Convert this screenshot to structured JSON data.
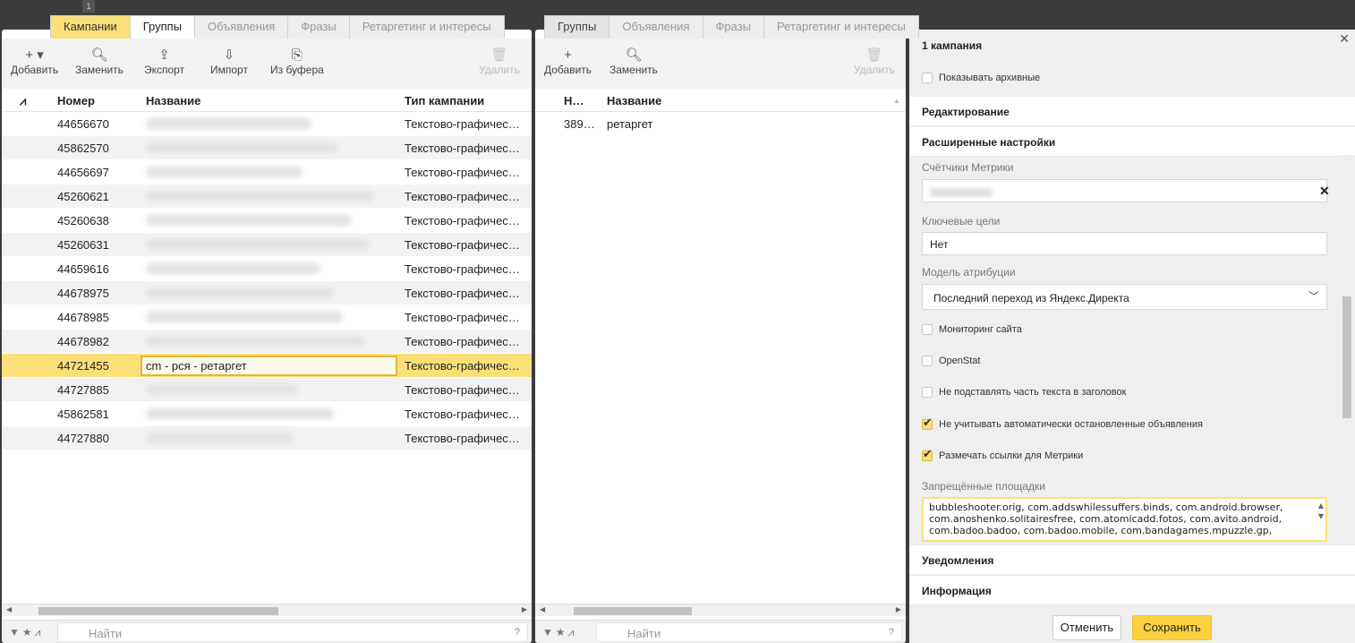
{
  "window_number": "1",
  "left_tabs": [
    {
      "label": "Кампании",
      "state": "active"
    },
    {
      "label": "Группы",
      "state": "selected"
    },
    {
      "label": "Объявления",
      "state": "inactive"
    },
    {
      "label": "Фразы",
      "state": "inactive"
    },
    {
      "label": "Ретаргетинг и интересы",
      "state": "inactive"
    }
  ],
  "middle_tabs": [
    {
      "label": "Группы",
      "state": "active"
    },
    {
      "label": "Объявления",
      "state": "inactive"
    },
    {
      "label": "Фразы",
      "state": "inactive"
    },
    {
      "label": "Ретаргетинг и интересы",
      "state": "inactive"
    }
  ],
  "left_toolbar": {
    "add": "Добавить",
    "replace": "Заменить",
    "export": "Экспорт",
    "import": "Импорт",
    "from_buffer": "Из буфера",
    "delete": "Удалить"
  },
  "middle_toolbar": {
    "add": "Добавить",
    "replace": "Заменить",
    "delete": "Удалить"
  },
  "campaigns_grid": {
    "columns": [
      "Номер",
      "Название",
      "Тип кампании"
    ],
    "rows": [
      {
        "number": "44656670",
        "name": "",
        "type": "Текстово-графичес…"
      },
      {
        "number": "45862570",
        "name": "",
        "type": "Текстово-графичес…"
      },
      {
        "number": "44656697",
        "name": "",
        "type": "Текстово-графичес…"
      },
      {
        "number": "45260621",
        "name": "",
        "type": "Текстово-графичес…"
      },
      {
        "number": "45260638",
        "name": "",
        "type": "Текстово-графичес…"
      },
      {
        "number": "45260631",
        "name": "",
        "type": "Текстово-графичес…"
      },
      {
        "number": "44659616",
        "name": "",
        "type": "Текстово-графичес…"
      },
      {
        "number": "44678975",
        "name": "",
        "type": "Текстово-графичес…"
      },
      {
        "number": "44678985",
        "name": "",
        "type": "Текстово-графичес…"
      },
      {
        "number": "44678982",
        "name": "",
        "type": "Текстово-графичес…"
      },
      {
        "number": "44721455",
        "name": "cm - рся - ретаргет",
        "type": "Текстово-графичес…"
      },
      {
        "number": "44727885",
        "name": "",
        "type": "Текстово-графичес…"
      },
      {
        "number": "45862581",
        "name": "",
        "type": "Текстово-графичес…"
      },
      {
        "number": "44727880",
        "name": "",
        "type": "Текстово-графичес…"
      }
    ]
  },
  "groups_grid": {
    "columns": [
      "Н…",
      "Название"
    ],
    "rows": [
      {
        "number": "389…",
        "name": "ретаргет"
      }
    ]
  },
  "search_placeholder": "Найти",
  "search_help": "?",
  "right_panel": {
    "title": "1 кампания",
    "show_archived": "Показывать архивные",
    "section_edit": "Редактирование",
    "section_advanced": "Расширенные настройки",
    "metrika_label": "Счётчики Метрики",
    "key_goals_label": "Ключевые цели",
    "key_goals_value": "Нет",
    "attribution_label": "Модель атрибуции",
    "attribution_value": "Последний переход из Яндекс.Директа",
    "checkboxes": [
      {
        "label": "Мониторинг сайта",
        "checked": false
      },
      {
        "label": "OpenStat",
        "checked": false
      },
      {
        "label": "Не подставлять часть текста в заголовок",
        "checked": false
      },
      {
        "label": "Не учитывать автоматически остановленные объявления",
        "checked": true
      },
      {
        "label": "Размечать ссылки для Метрики",
        "checked": true
      }
    ],
    "forbidden_label": "Запрещённые площадки",
    "forbidden_value": "bubbleshooter.orig, com.addswhilessuffers.binds, com.android.browser, com.anoshenko.solitairesfree, com.atomicadd.fotos, com.avito.android, com.badoo.badoo, com.badoo.mobile, com.bandagames.mpuzzle.gp,",
    "section_notifications": "Уведомления",
    "section_info": "Информация",
    "cancel": "Отменить",
    "save": "Сохранить"
  }
}
